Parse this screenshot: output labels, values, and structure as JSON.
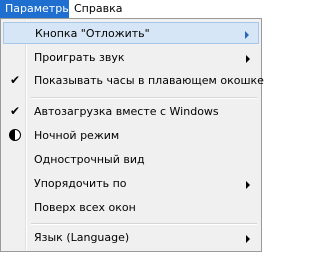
{
  "menubar": {
    "items": [
      {
        "label": "Параметры"
      },
      {
        "label": "Справка"
      }
    ]
  },
  "menu": {
    "items": [
      {
        "label": "Кнопка \"Отложить\"",
        "has_submenu": true,
        "highlighted": true
      },
      {
        "label": "Проиграть звук",
        "has_submenu": true
      },
      {
        "label": "Показывать часы в плавающем окошке",
        "checked": true,
        "icon": "check-icon"
      },
      {
        "label": "Автозагрузка вместе с Windows",
        "checked": true,
        "icon": "check-icon"
      },
      {
        "label": "Ночной режим",
        "icon": "half-circle-icon"
      },
      {
        "label": "Однострочный вид"
      },
      {
        "label": "Упорядочить по",
        "has_submenu": true
      },
      {
        "label": "Поверх всех окон"
      },
      {
        "label": "Язык (Language)",
        "has_submenu": true
      }
    ],
    "check_glyph": "✔"
  },
  "colors": {
    "menubar_active": "#1f6fd1",
    "highlight_bg": "#d7e6f6",
    "highlight_border": "#a8c8ea",
    "menu_bg": "#f0f0f0"
  }
}
